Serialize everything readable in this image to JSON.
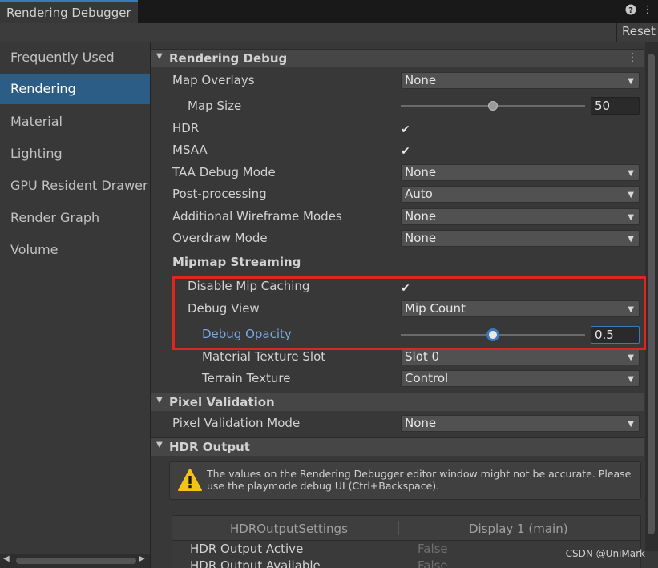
{
  "window": {
    "tab_title": "Rendering Debugger",
    "help_icon": "help-icon",
    "menu_icon": "kebab-menu-icon",
    "reset_label": "Reset"
  },
  "sidebar": {
    "items": [
      {
        "label": "Frequently Used",
        "selected": false
      },
      {
        "label": "Rendering",
        "selected": true
      },
      {
        "label": "Material",
        "selected": false
      },
      {
        "label": "Lighting",
        "selected": false
      },
      {
        "label": "GPU Resident Drawer",
        "selected": false
      },
      {
        "label": "Render Graph",
        "selected": false
      },
      {
        "label": "Volume",
        "selected": false
      }
    ]
  },
  "rendering_debug": {
    "title": "Rendering Debug",
    "map_overlays": {
      "label": "Map Overlays",
      "value": "None"
    },
    "map_size": {
      "label": "Map Size",
      "value": "50",
      "fraction": 0.5
    },
    "hdr": {
      "label": "HDR",
      "checked": true
    },
    "msaa": {
      "label": "MSAA",
      "checked": true
    },
    "taa_debug_mode": {
      "label": "TAA Debug Mode",
      "value": "None"
    },
    "post_processing": {
      "label": "Post-processing",
      "value": "Auto"
    },
    "additional_wireframe_modes": {
      "label": "Additional Wireframe Modes",
      "value": "None"
    },
    "overdraw_mode": {
      "label": "Overdraw Mode",
      "value": "None"
    }
  },
  "mipmap_streaming": {
    "title": "Mipmap Streaming",
    "disable_mip_caching": {
      "label": "Disable Mip Caching",
      "checked": true
    },
    "debug_view": {
      "label": "Debug View",
      "value": "Mip Count"
    },
    "debug_opacity": {
      "label": "Debug Opacity",
      "value": "0.5",
      "fraction": 0.5
    },
    "material_texture_slot": {
      "label": "Material Texture Slot",
      "value": "Slot 0"
    },
    "terrain_texture": {
      "label": "Terrain Texture",
      "value": "Control"
    }
  },
  "pixel_validation": {
    "title": "Pixel Validation",
    "mode": {
      "label": "Pixel Validation Mode",
      "value": "None"
    }
  },
  "hdr_output": {
    "title": "HDR Output",
    "warning_icon": "warning-icon",
    "warning_text": "The values on the Rendering Debugger editor window might not be accurate. Please use the playmode debug UI (Ctrl+Backspace).",
    "table": {
      "headers": [
        "HDROutputSettings",
        "Display 1 (main)"
      ],
      "rows": [
        {
          "name": "HDR Output Active",
          "value": "False"
        },
        {
          "name": "HDR Output Available",
          "value": "False"
        }
      ]
    }
  },
  "watermark": "CSDN @UniMark",
  "colors": {
    "accent": "#3a79bb",
    "selected_item": "#2c5d87",
    "highlight_box": "#e1241c",
    "warning": "#f3c316"
  }
}
